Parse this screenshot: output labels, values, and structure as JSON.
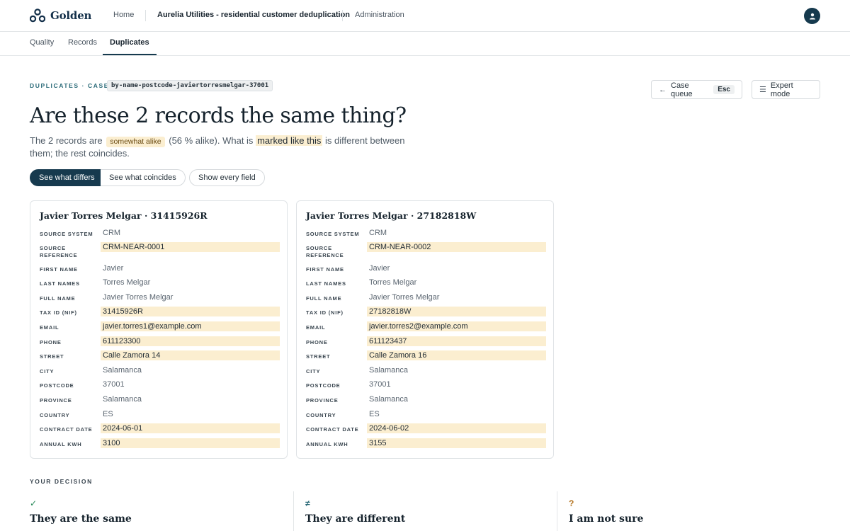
{
  "header": {
    "brand": "Golden",
    "nav_home": "Home",
    "project": "Aurelia Utilities - residential customer deduplication",
    "nav_admin": "Administration",
    "avatar_icon": "user-icon"
  },
  "tabs": [
    {
      "label": "Quality"
    },
    {
      "label": "Records"
    },
    {
      "label": "Duplicates",
      "active": true
    }
  ],
  "case": {
    "eyebrow": "DUPLICATES · CASE",
    "code": "by-name-postcode-javiertorresmelgar-37001",
    "case_queue_label": "Case queue",
    "case_queue_key": "Esc",
    "expert_mode_label": "Expert mode"
  },
  "title": "Are these 2 records the same thing?",
  "intro": {
    "p1": "The 2 records are",
    "alike_badge": "somewhat alike",
    "p2": "(56 % alike). What is",
    "marked": "marked like this",
    "p3": "is different between them; the rest coincides."
  },
  "filters": {
    "differs": "See what differs",
    "coincides": "See what coincides",
    "every": "Show every field"
  },
  "records": [
    {
      "title": "Javier Torres Melgar · 31415926R",
      "fields": [
        {
          "label": "SOURCE SYSTEM",
          "value": "CRM",
          "diff": false
        },
        {
          "label": "SOURCE REFERENCE",
          "value": "CRM-NEAR-0001",
          "diff": true
        },
        {
          "label": "FIRST NAME",
          "value": "Javier",
          "diff": false
        },
        {
          "label": "LAST NAMES",
          "value": "Torres Melgar",
          "diff": false
        },
        {
          "label": "FULL NAME",
          "value": "Javier Torres Melgar",
          "diff": false
        },
        {
          "label": "TAX ID (NIF)",
          "value": "31415926R",
          "diff": true
        },
        {
          "label": "EMAIL",
          "value": "javier.torres1@example.com",
          "diff": true
        },
        {
          "label": "PHONE",
          "value": "611123300",
          "diff": true
        },
        {
          "label": "STREET",
          "value": "Calle Zamora 14",
          "diff": true
        },
        {
          "label": "CITY",
          "value": "Salamanca",
          "diff": false
        },
        {
          "label": "POSTCODE",
          "value": "37001",
          "diff": false
        },
        {
          "label": "PROVINCE",
          "value": "Salamanca",
          "diff": false
        },
        {
          "label": "COUNTRY",
          "value": "ES",
          "diff": false
        },
        {
          "label": "CONTRACT DATE",
          "value": "2024-06-01",
          "diff": true
        },
        {
          "label": "ANNUAL KWH",
          "value": "3100",
          "diff": true
        }
      ]
    },
    {
      "title": "Javier Torres Melgar · 27182818W",
      "fields": [
        {
          "label": "SOURCE SYSTEM",
          "value": "CRM",
          "diff": false
        },
        {
          "label": "SOURCE REFERENCE",
          "value": "CRM-NEAR-0002",
          "diff": true
        },
        {
          "label": "FIRST NAME",
          "value": "Javier",
          "diff": false
        },
        {
          "label": "LAST NAMES",
          "value": "Torres Melgar",
          "diff": false
        },
        {
          "label": "FULL NAME",
          "value": "Javier Torres Melgar",
          "diff": false
        },
        {
          "label": "TAX ID (NIF)",
          "value": "27182818W",
          "diff": true
        },
        {
          "label": "EMAIL",
          "value": "javier.torres2@example.com",
          "diff": true
        },
        {
          "label": "PHONE",
          "value": "611123437",
          "diff": true
        },
        {
          "label": "STREET",
          "value": "Calle Zamora 16",
          "diff": true
        },
        {
          "label": "CITY",
          "value": "Salamanca",
          "diff": false
        },
        {
          "label": "POSTCODE",
          "value": "37001",
          "diff": false
        },
        {
          "label": "PROVINCE",
          "value": "Salamanca",
          "diff": false
        },
        {
          "label": "COUNTRY",
          "value": "ES",
          "diff": false
        },
        {
          "label": "CONTRACT DATE",
          "value": "2024-06-02",
          "diff": true
        },
        {
          "label": "ANNUAL KWH",
          "value": "3155",
          "diff": true
        }
      ]
    }
  ],
  "decision": {
    "eyebrow": "YOUR DECISION",
    "options": [
      {
        "icon": "✓",
        "icon_name": "check-icon",
        "label": "They are the same",
        "color": "#2a8a5a"
      },
      {
        "icon": "≠",
        "icon_name": "not-equal-icon",
        "label": "They are different",
        "color": "#2a6a78"
      },
      {
        "icon": "?",
        "icon_name": "question-icon",
        "label": "I am not sure",
        "color": "#b2701a"
      }
    ]
  },
  "colors": {
    "primary": "#163a4e",
    "diff_highlight": "#fbeed0",
    "accent_teal": "#2a6a78"
  }
}
